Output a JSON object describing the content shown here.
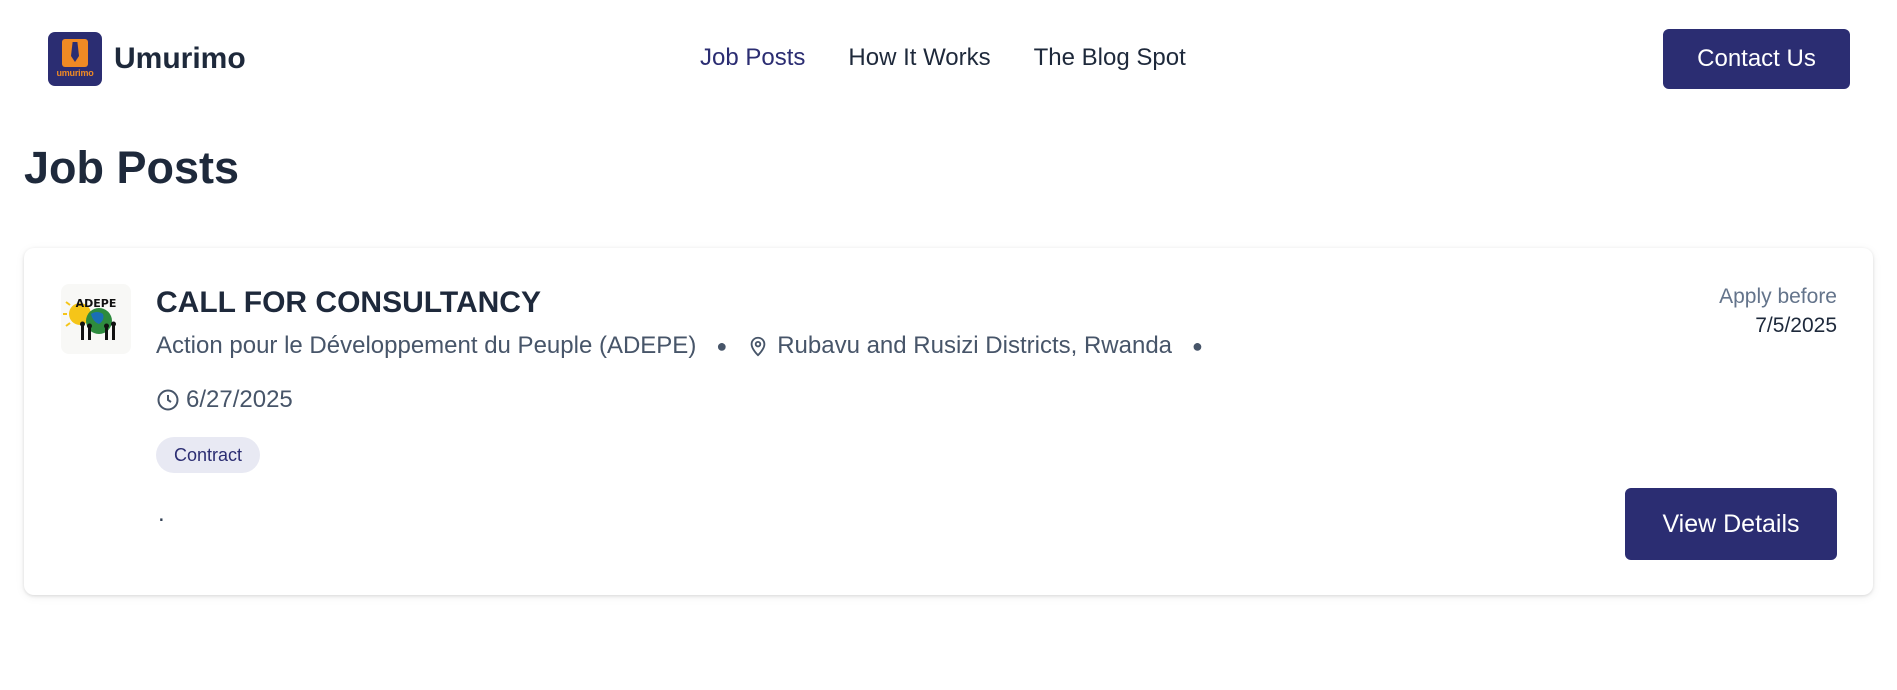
{
  "header": {
    "logo_text": "umurimo",
    "brand_name": "Umurimo",
    "nav": [
      {
        "label": "Job Posts",
        "active": true
      },
      {
        "label": "How It Works",
        "active": false
      },
      {
        "label": "The Blog Spot",
        "active": false
      }
    ],
    "contact_label": "Contact Us"
  },
  "page": {
    "title": "Job Posts"
  },
  "job": {
    "logo_text": "ADEPE",
    "title": "CALL FOR CONSULTANCY",
    "organization": "Action pour le Développement du Peuple (ADEPE)",
    "location": "Rubavu and Rusizi Districts, Rwanda",
    "posted_date": "6/27/2025",
    "tag": "Contract",
    "description": ".",
    "apply_label": "Apply before",
    "apply_date": "7/5/2025",
    "view_label": "View Details"
  },
  "colors": {
    "brand": "#2b2d72",
    "accent": "#f08a24",
    "text": "#1e293b",
    "muted": "#475569",
    "tag_bg": "#e8e9f3"
  },
  "icons": {
    "location": "map-pin-icon",
    "date": "clock-icon"
  }
}
